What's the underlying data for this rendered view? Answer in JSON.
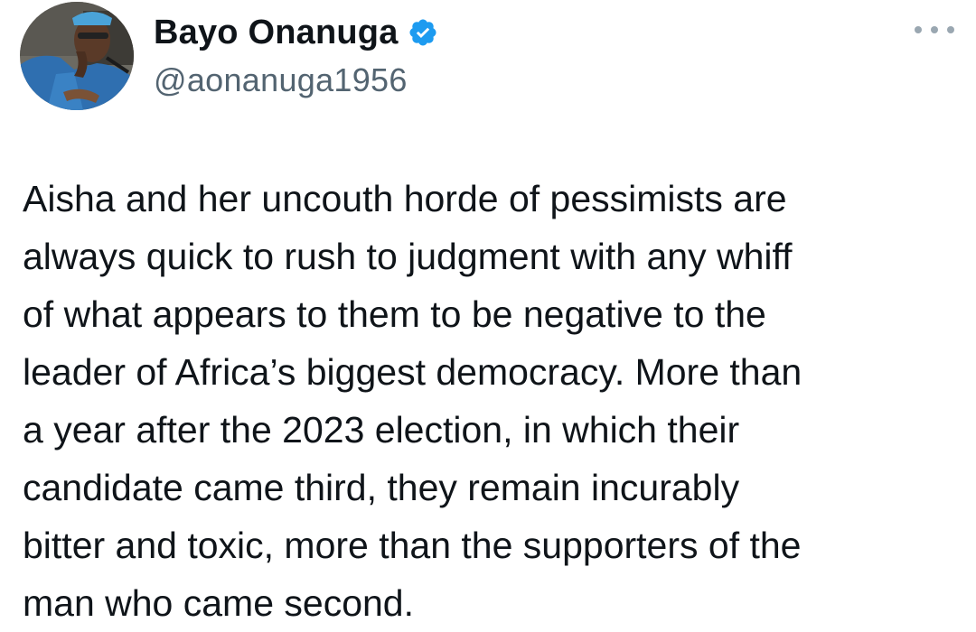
{
  "author": {
    "display_name": "Bayo Onanuga",
    "handle": "@aonanuga1956",
    "verified": true,
    "verified_icon": "verified-badge-icon",
    "avatar_icon": "profile-photo"
  },
  "menu": {
    "icon": "more-options-icon"
  },
  "tweet": {
    "lines": [
      "Aisha and her uncouth horde of pessimists are",
      "always quick to rush to judgment with any whiff",
      "of what appears to them to be negative to the",
      "leader of Africa’s biggest democracy. More than",
      "a year after the 2023 election, in which their",
      "candidate came third, they remain incurably",
      "bitter and toxic, more than the supporters of the",
      "man who came second."
    ]
  },
  "colors": {
    "text": "#0f1419",
    "secondary_text": "#536471",
    "verified_blue": "#1d9bf0",
    "menu_dots": "#9aa7b1"
  }
}
